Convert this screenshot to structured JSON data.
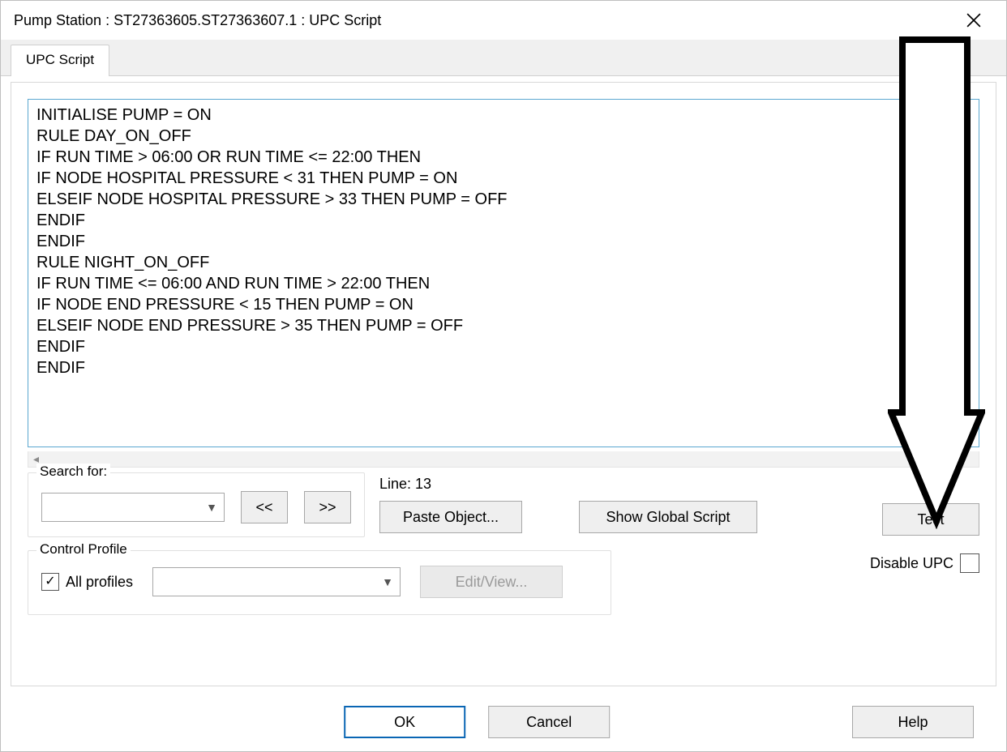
{
  "title": "Pump Station : ST27363605.ST27363607.1 : UPC Script",
  "tab_label": "UPC Script",
  "script_text": "INITIALISE PUMP = ON\nRULE DAY_ON_OFF\nIF RUN TIME > 06:00 OR RUN TIME <= 22:00 THEN\nIF NODE HOSPITAL PRESSURE < 31 THEN PUMP = ON\nELSEIF NODE HOSPITAL PRESSURE > 33 THEN PUMP = OFF\nENDIF\nENDIF\nRULE NIGHT_ON_OFF\nIF RUN TIME <= 06:00 AND RUN TIME > 22:00 THEN\nIF NODE END PRESSURE < 15 THEN PUMP = ON\nELSEIF NODE END PRESSURE > 35 THEN PUMP = OFF\nENDIF\nENDIF",
  "search": {
    "legend": "Search for:",
    "value": "",
    "prev": "<<",
    "next": ">>"
  },
  "line_label": "Line: 13",
  "buttons": {
    "paste_object": "Paste Object...",
    "show_global": "Show Global Script",
    "test": "Test",
    "edit_view": "Edit/View...",
    "ok": "OK",
    "cancel": "Cancel",
    "help": "Help"
  },
  "profile": {
    "legend": "Control Profile",
    "all_profiles_label": "All profiles",
    "all_profiles_checked": true,
    "selected": ""
  },
  "disable_upc": {
    "label": "Disable UPC",
    "checked": false
  }
}
